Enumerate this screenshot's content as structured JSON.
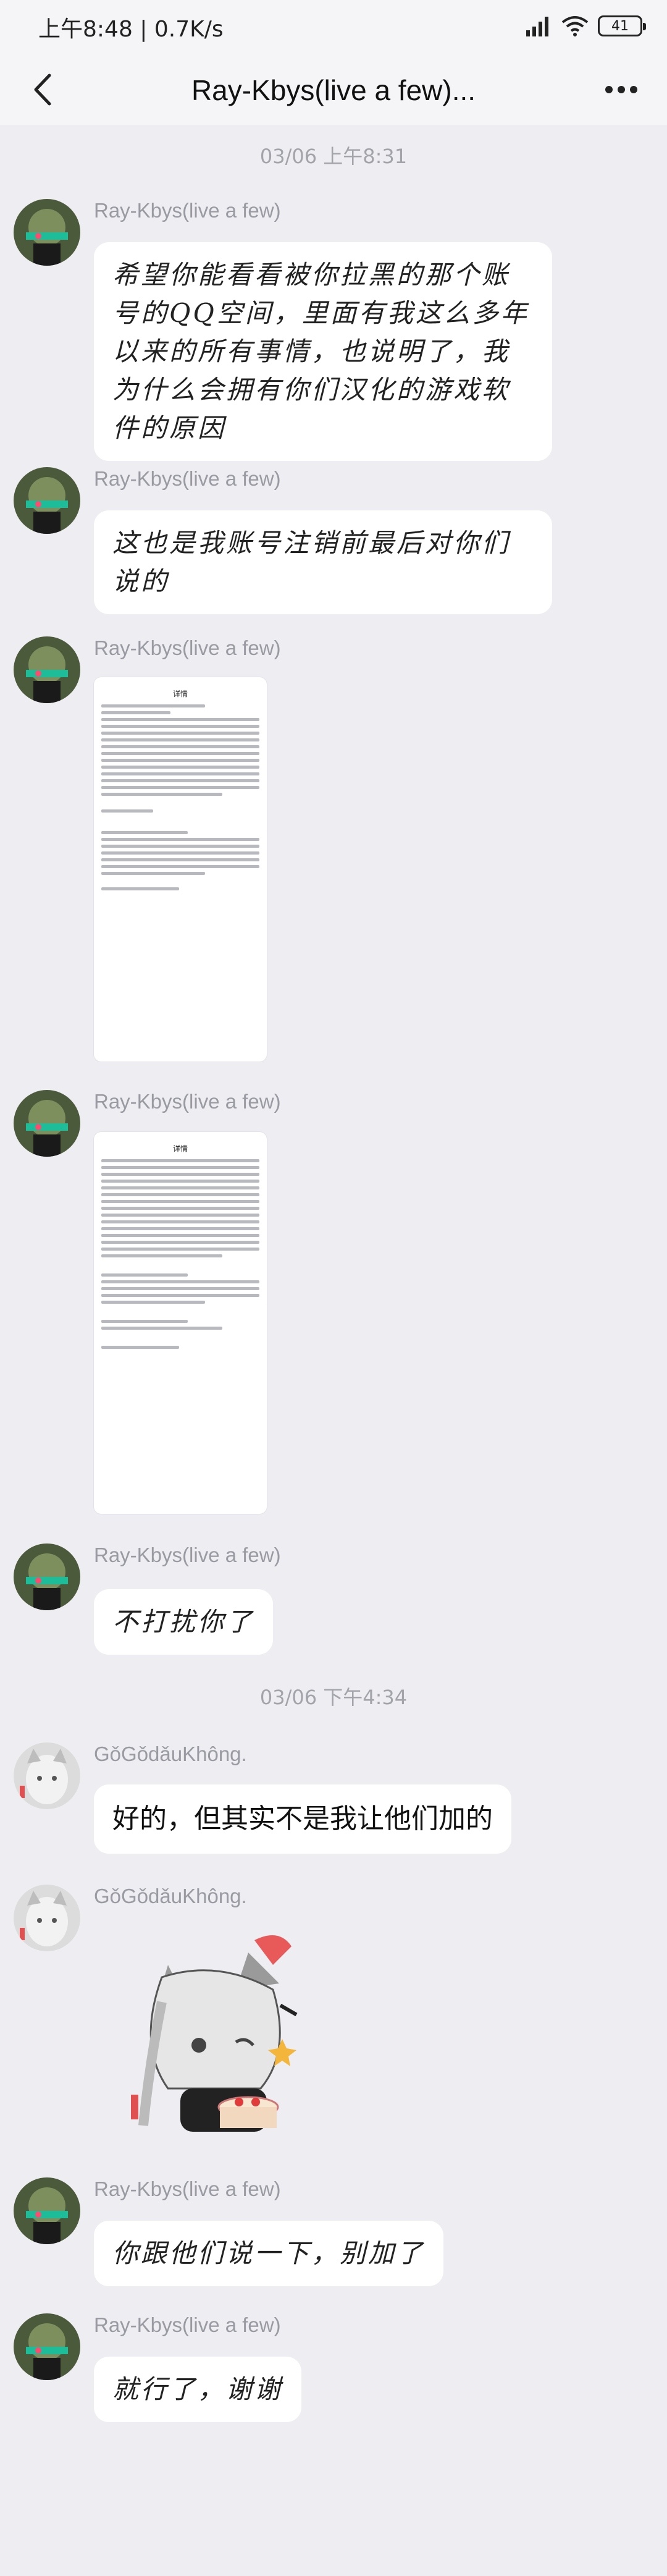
{
  "status_bar": {
    "time_speed": "上午8:48 | 0.7K/s",
    "battery": "41"
  },
  "header": {
    "title": "Ray-Kbys(live a few)..."
  },
  "timestamps": {
    "first": "03/06 上午8:31",
    "second": "03/06 下午4:34"
  },
  "screenshot_preview": {
    "title": "详情"
  },
  "messages": [
    {
      "sender": "Ray-Kbys(live a few)",
      "text": "希望你能看看被你拉黑的那个账号的QQ空间，里面有我这么多年以来的所有事情，也说明了，我为什么会拥有你们汉化的游戏软件的原因"
    },
    {
      "sender": "Ray-Kbys(live a few)",
      "text": "这也是我账号注销前最后对你们说的"
    },
    {
      "sender": "Ray-Kbys(live a few)"
    },
    {
      "sender": "Ray-Kbys(live a few)"
    },
    {
      "sender": "Ray-Kbys(live a few)",
      "text": "不打扰你了"
    },
    {
      "sender": "GǒGǒdǎuKhông.",
      "text": "好的，但其实不是我让他们加的"
    },
    {
      "sender": "GǒGǒdǎuKhông."
    },
    {
      "sender": "Ray-Kbys(live a few)",
      "text": "你跟他们说一下，别加了"
    },
    {
      "sender": "Ray-Kbys(live a few)",
      "text": "就行了，谢谢"
    }
  ],
  "colors": {
    "background": "#ededf2",
    "bubble": "#ffffff",
    "meta_text": "#9a9aa2"
  }
}
